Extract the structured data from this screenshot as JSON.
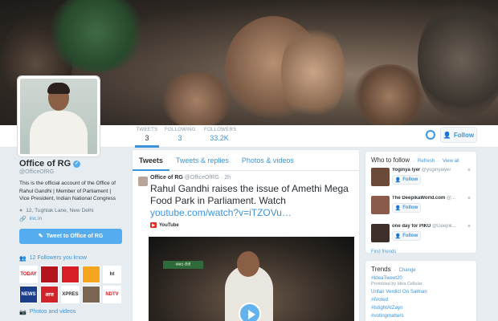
{
  "header": {
    "stats": [
      {
        "label": "TWEETS",
        "value": "3"
      },
      {
        "label": "FOLLOWING",
        "value": "3"
      },
      {
        "label": "FOLLOWERS",
        "value": "33.2K"
      }
    ],
    "follow_label": "Follow"
  },
  "profile": {
    "name": "Office of RG",
    "handle": "@OfficeOfRG",
    "bio": "This is the official account of the Office of Rahul Gandhi | Member of Parliament | Vice President, Indian National Congress",
    "location": "12, Tughlak Lane, New Delhi",
    "url": "inc.in",
    "tweet_to_label": "Tweet to Office of RG",
    "followers_you_know": "12 Followers you know",
    "photos_videos": "Photos and videos",
    "follower_logos": [
      {
        "text": "TODAY",
        "color": "#ffffff",
        "fg": "#c4161c"
      },
      {
        "text": "",
        "color": "#b4151c",
        "fg": "#ffffff"
      },
      {
        "text": "",
        "color": "#d81f26",
        "fg": "#ffffff"
      },
      {
        "text": "",
        "color": "#f6a61e",
        "fg": "#ffffff"
      },
      {
        "text": "ht",
        "color": "#ffffff",
        "fg": "#222222"
      },
      {
        "text": "NEWS",
        "color": "#1b3e8a",
        "fg": "#ffffff"
      },
      {
        "text": "आज",
        "color": "#d2232a",
        "fg": "#ffffff"
      },
      {
        "text": "EXPRESS",
        "color": "#ffffff",
        "fg": "#333333"
      },
      {
        "text": "",
        "color": "#7a6552",
        "fg": "#ffffff"
      },
      {
        "text": "NDTV",
        "color": "#ffffff",
        "fg": "#d2232a"
      }
    ]
  },
  "timeline": {
    "tabs": [
      "Tweets",
      "Tweets & replies",
      "Photos & videos"
    ],
    "tweet": {
      "name": "Office of RG",
      "handle": "@OfficeOfRG",
      "time": "2h",
      "text": "Rahul Gandhi raises the issue of Amethi Mega Food Park in Parliament. Watch",
      "link": "youtube.com/watch?v=iTZOVu…",
      "source": "YouTube",
      "video_banner": "संसद टीवी"
    }
  },
  "who_to_follow": {
    "title": "Who to follow",
    "refresh": "Refresh",
    "view_all": "View all",
    "suggestions": [
      {
        "name": "Yoginya Iyer",
        "handle": "@yoginyaiyer",
        "color": "#6b4a3a"
      },
      {
        "name": "The DeepikaWorld.com",
        "handle": "@...",
        "color": "#8a5a4a"
      },
      {
        "name": "one day for PIKU",
        "handle": "@Deepik...",
        "color": "#3e2f2a"
      }
    ],
    "follow_label": "Follow",
    "find_friends": "Find friends"
  },
  "trends": {
    "title": "Trends",
    "change": "Change",
    "items": [
      {
        "text": "#IdeaTweet20",
        "sub": "Promoted by Idea Cellular"
      },
      {
        "text": "Unfair Verdict On Salman",
        "sub": ""
      },
      {
        "text": "#IVoted",
        "sub": ""
      },
      {
        "text": "#IstightAtZayn",
        "sub": ""
      },
      {
        "text": "#votingmatters",
        "sub": ""
      }
    ]
  },
  "colors": {
    "accent": "#55acee",
    "link": "#3b94d9",
    "background": "#e6ecf0"
  }
}
